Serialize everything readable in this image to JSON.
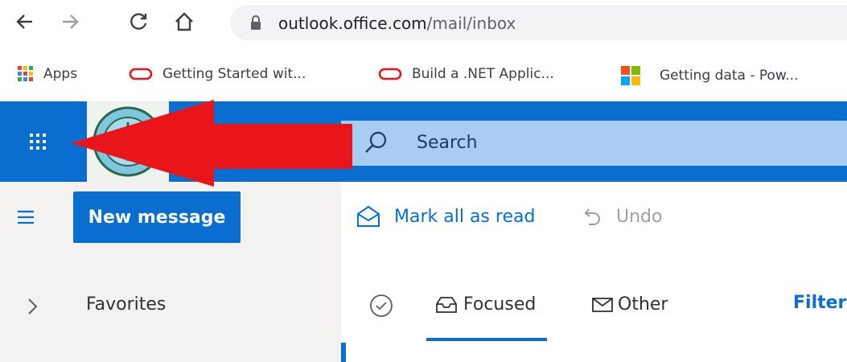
{
  "browser": {
    "url_domain": "outlook.office.com",
    "url_path": "/mail/inbox"
  },
  "bookmarks": [
    {
      "label": "Apps",
      "icon": "apps-grid-icon"
    },
    {
      "label": "Getting Started wit...",
      "icon": "oracle-icon"
    },
    {
      "label": "Build a .NET Applic...",
      "icon": "oracle-icon"
    },
    {
      "label": "Getting data - Pow...",
      "icon": "microsoft-icon"
    }
  ],
  "header": {
    "search_placeholder": "Search"
  },
  "commandbar": {
    "new_message": "New message",
    "mark_all_read": "Mark all as read",
    "undo": "Undo"
  },
  "nav": {
    "favorites": "Favorites"
  },
  "list": {
    "focused": "Focused",
    "other": "Other",
    "filter": "Filter"
  },
  "colors": {
    "brand": "#0a6ed1",
    "annotation_arrow": "#e8151b"
  }
}
